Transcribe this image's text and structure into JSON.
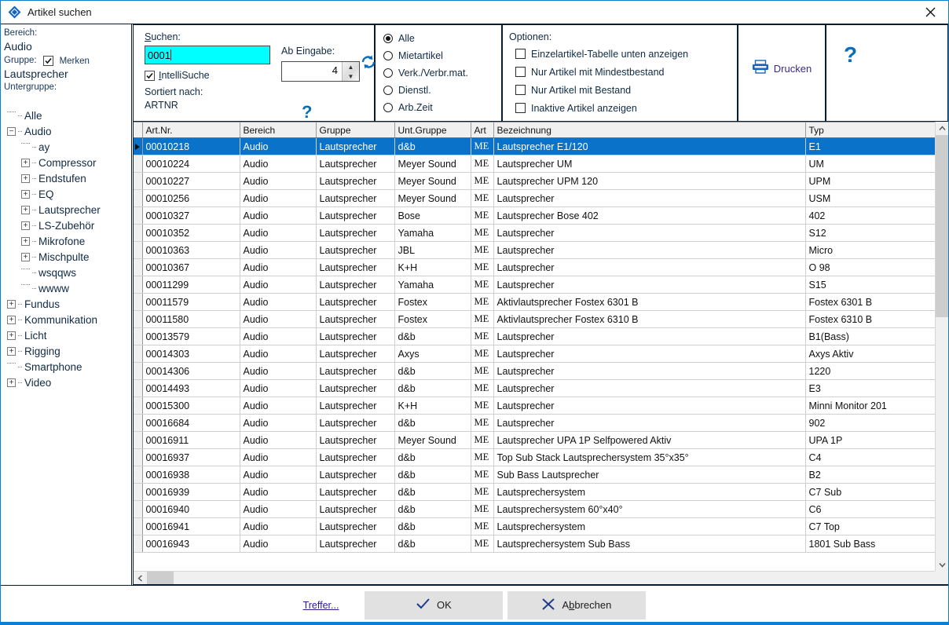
{
  "window": {
    "title": "Artikel suchen",
    "icon": "app-diamond-icon",
    "close_label": "×",
    "accent_color": "#0a7fd4"
  },
  "leftpanel": {
    "bereich_label": "Bereich:",
    "bereich_value": "Audio",
    "gruppe_label": "Gruppe:",
    "merken_label": "Merken",
    "merken_checked": true,
    "gruppe_value": "Lautsprecher",
    "untergruppe_label": "Untergruppe:",
    "tree": [
      {
        "label": "Alle",
        "depth": 0,
        "expander": "none"
      },
      {
        "label": "Audio",
        "depth": 0,
        "expander": "minus"
      },
      {
        "label": "ay",
        "depth": 1,
        "expander": "none"
      },
      {
        "label": "Compressor",
        "depth": 1,
        "expander": "plus"
      },
      {
        "label": "Endstufen",
        "depth": 1,
        "expander": "plus"
      },
      {
        "label": "EQ",
        "depth": 1,
        "expander": "plus"
      },
      {
        "label": "Lautsprecher",
        "depth": 1,
        "expander": "plus"
      },
      {
        "label": "LS-Zubehör",
        "depth": 1,
        "expander": "plus"
      },
      {
        "label": "Mikrofone",
        "depth": 1,
        "expander": "plus"
      },
      {
        "label": "Mischpulte",
        "depth": 1,
        "expander": "plus"
      },
      {
        "label": "wsqqws",
        "depth": 1,
        "expander": "none"
      },
      {
        "label": "wwww",
        "depth": 1,
        "expander": "none"
      },
      {
        "label": "Fundus",
        "depth": 0,
        "expander": "plus"
      },
      {
        "label": "Kommunikation",
        "depth": 0,
        "expander": "plus"
      },
      {
        "label": "Licht",
        "depth": 0,
        "expander": "plus"
      },
      {
        "label": "Rigging",
        "depth": 0,
        "expander": "plus"
      },
      {
        "label": "Smartphone",
        "depth": 0,
        "expander": "none"
      },
      {
        "label": "Video",
        "depth": 0,
        "expander": "plus"
      }
    ]
  },
  "search": {
    "suchen_label": "Suchen:",
    "suchen_value": "0001",
    "intellisuche_label": "IntelliSuche",
    "intellisuche_checked": true,
    "sortiert_label": "Sortiert nach:",
    "sortiert_value": "ARTNR",
    "ab_eingabe_label": "Ab Eingabe:",
    "ab_eingabe_value": "4",
    "refresh_icon": "refresh-icon",
    "help_small_label": "?"
  },
  "filter": {
    "options": [
      {
        "label": "Alle",
        "selected": true
      },
      {
        "label": "Mietartikel",
        "selected": false
      },
      {
        "label": "Verk./Verbr.mat.",
        "selected": false
      },
      {
        "label": "Dienstl.",
        "selected": false
      },
      {
        "label": "Arb.Zeit",
        "selected": false
      }
    ]
  },
  "optionen": {
    "title": "Optionen:",
    "items": [
      {
        "label": "Einzelartikel-Tabelle unten anzeigen",
        "checked": false
      },
      {
        "label": "Nur Artikel mit Mindestbestand",
        "checked": false
      },
      {
        "label": "Nur Artikel mit Bestand",
        "checked": false
      },
      {
        "label": "Inaktive Artikel anzeigen",
        "checked": false
      }
    ]
  },
  "actions": {
    "print_label": "Drucken",
    "print_icon": "printer-icon",
    "help_label": "?"
  },
  "grid": {
    "columns": [
      "Art.Nr.",
      "Bereich",
      "Gruppe",
      "Unt.Gruppe",
      "Art",
      "Bezeichnung",
      "Typ"
    ],
    "selected_index": 0,
    "rows": [
      [
        "00010218",
        "Audio",
        "Lautsprecher",
        "d&b",
        "ME",
        "Lautsprecher E1/120",
        "E1"
      ],
      [
        "00010224",
        "Audio",
        "Lautsprecher",
        "Meyer Sound",
        "ME",
        "Lautsprecher UM",
        "UM"
      ],
      [
        "00010227",
        "Audio",
        "Lautsprecher",
        "Meyer Sound",
        "ME",
        "Lautsprecher UPM 120",
        "UPM"
      ],
      [
        "00010256",
        "Audio",
        "Lautsprecher",
        "Meyer Sound",
        "ME",
        "Lautsprecher",
        "USM"
      ],
      [
        "00010327",
        "Audio",
        "Lautsprecher",
        "Bose",
        "ME",
        "Lautsprecher Bose 402",
        "402"
      ],
      [
        "00010352",
        "Audio",
        "Lautsprecher",
        "Yamaha",
        "ME",
        "Lautsprecher",
        "S12"
      ],
      [
        "00010363",
        "Audio",
        "Lautsprecher",
        "JBL",
        "ME",
        "Lautsprecher",
        "Micro"
      ],
      [
        "00010367",
        "Audio",
        "Lautsprecher",
        "K+H",
        "ME",
        "Lautsprecher",
        "O 98"
      ],
      [
        "00011299",
        "Audio",
        "Lautsprecher",
        "Yamaha",
        "ME",
        "Lautsprecher",
        "S15"
      ],
      [
        "00011579",
        "Audio",
        "Lautsprecher",
        "Fostex",
        "ME",
        "Aktivlautsprecher Fostex 6301 B",
        "Fostex 6301 B"
      ],
      [
        "00011580",
        "Audio",
        "Lautsprecher",
        "Fostex",
        "ME",
        "Aktivlautsprecher Fostex 6310 B",
        "Fostex 6310 B"
      ],
      [
        "00013579",
        "Audio",
        "Lautsprecher",
        "d&b",
        "ME",
        "Lautsprecher",
        "B1(Bass)"
      ],
      [
        "00014303",
        "Audio",
        "Lautsprecher",
        "Axys",
        "ME",
        "Lautsprecher",
        "Axys Aktiv"
      ],
      [
        "00014306",
        "Audio",
        "Lautsprecher",
        "d&b",
        "ME",
        "Lautsprecher",
        "1220"
      ],
      [
        "00014493",
        "Audio",
        "Lautsprecher",
        "d&b",
        "ME",
        "Lautsprecher",
        "E3"
      ],
      [
        "00015300",
        "Audio",
        "Lautsprecher",
        "K+H",
        "ME",
        "Lautsprecher",
        "Minni Monitor 201"
      ],
      [
        "00016684",
        "Audio",
        "Lautsprecher",
        "d&b",
        "ME",
        "Lautsprecher",
        "902"
      ],
      [
        "00016911",
        "Audio",
        "Lautsprecher",
        "Meyer Sound",
        "ME",
        "Lautsprecher UPA 1P Selfpowered Aktiv",
        "UPA 1P"
      ],
      [
        "00016937",
        "Audio",
        "Lautsprecher",
        "d&b",
        "ME",
        "Top Sub Stack Lautsprechersystem 35°x35°",
        "C4"
      ],
      [
        "00016938",
        "Audio",
        "Lautsprecher",
        "d&b",
        "ME",
        "Sub Bass Lautsprecher",
        "B2"
      ],
      [
        "00016939",
        "Audio",
        "Lautsprecher",
        "d&b",
        "ME",
        "Lautsprechersystem",
        "C7 Sub"
      ],
      [
        "00016940",
        "Audio",
        "Lautsprecher",
        "d&b",
        "ME",
        "Lautsprechersystem 60°x40°",
        "C6"
      ],
      [
        "00016941",
        "Audio",
        "Lautsprecher",
        "d&b",
        "ME",
        "Lautsprechersystem",
        "C7 Top"
      ],
      [
        "00016943",
        "Audio",
        "Lautsprecher",
        "d&b",
        "ME",
        "Lautsprechersystem Sub Bass",
        "1801 Sub Bass"
      ]
    ]
  },
  "footer": {
    "treffer_label": "Treffer...",
    "ok_label": "OK",
    "cancel_label": "Abbrechen"
  },
  "colors": {
    "cell_highlight": "#00ffff",
    "row_selected": "#0a72c8",
    "accent": "#0a7fd4",
    "link": "#2a1b9a"
  }
}
